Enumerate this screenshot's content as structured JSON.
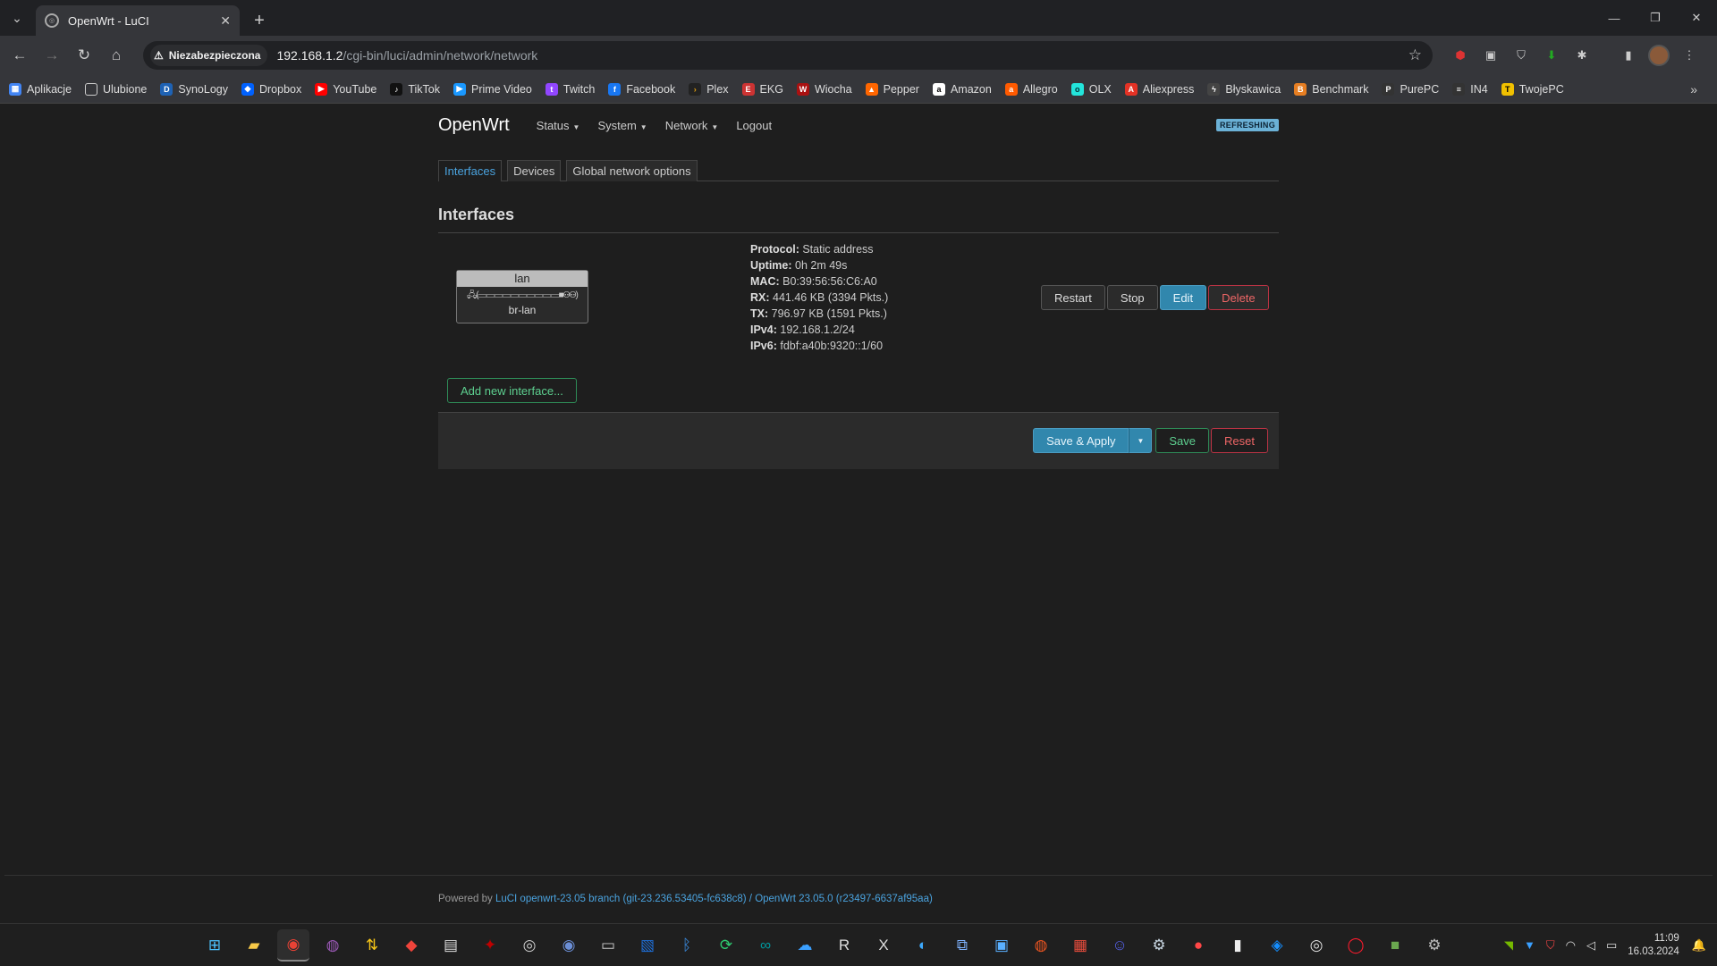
{
  "browser": {
    "tab_title": "OpenWrt - LuCI",
    "insecure_label": "Niezabezpieczona",
    "url_host": "192.168.1.2",
    "url_path": "/cgi-bin/luci/admin/network/network",
    "bookmarks": [
      "Aplikacje",
      "Ulubione",
      "SynoLogy",
      "Dropbox",
      "YouTube",
      "TikTok",
      "Prime Video",
      "Twitch",
      "Facebook",
      "Plex",
      "EKG",
      "Wiocha",
      "Pepper",
      "Amazon",
      "Allegro",
      "OLX",
      "Aliexpress",
      "Błyskawica",
      "Benchmark",
      "PurePC",
      "IN4",
      "TwojePC"
    ]
  },
  "luci": {
    "brand": "OpenWrt",
    "menu": [
      "Status",
      "System",
      "Network",
      "Logout"
    ],
    "refresh_badge": "REFRESHING",
    "tabs": [
      "Interfaces",
      "Devices",
      "Global network options"
    ],
    "section_title": "Interfaces",
    "interface": {
      "name": "lan",
      "device": "br-lan",
      "protocol_label": "Protocol:",
      "protocol": "Static address",
      "uptime_label": "Uptime:",
      "uptime": "0h 2m 49s",
      "mac_label": "MAC:",
      "mac": "B0:39:56:56:C6:A0",
      "rx_label": "RX:",
      "rx": "441.46 KB (3394 Pkts.)",
      "tx_label": "TX:",
      "tx": "796.97 KB (1591 Pkts.)",
      "ipv4_label": "IPv4:",
      "ipv4": "192.168.1.2/24",
      "ipv6_label": "IPv6:",
      "ipv6": "fdbf:a40b:9320::1/60"
    },
    "buttons": {
      "restart": "Restart",
      "stop": "Stop",
      "edit": "Edit",
      "delete": "Delete",
      "add_interface": "Add new interface...",
      "save_apply": "Save & Apply",
      "save": "Save",
      "reset": "Reset"
    },
    "footer": {
      "powered_by": "Powered by",
      "luci_link": "LuCI openwrt-23.05 branch (git-23.236.53405-fc638c8)",
      "slash": " / ",
      "openwrt_link": "OpenWrt 23.05.0 (r23497-6637af95aa)"
    }
  },
  "taskbar": {
    "time": "11:09",
    "date": "16.03.2024"
  },
  "colors": {
    "accent": "#4aa3df",
    "edit_button": "#3187ad",
    "positive": "#5dcf8f",
    "negative": "#e66666"
  }
}
